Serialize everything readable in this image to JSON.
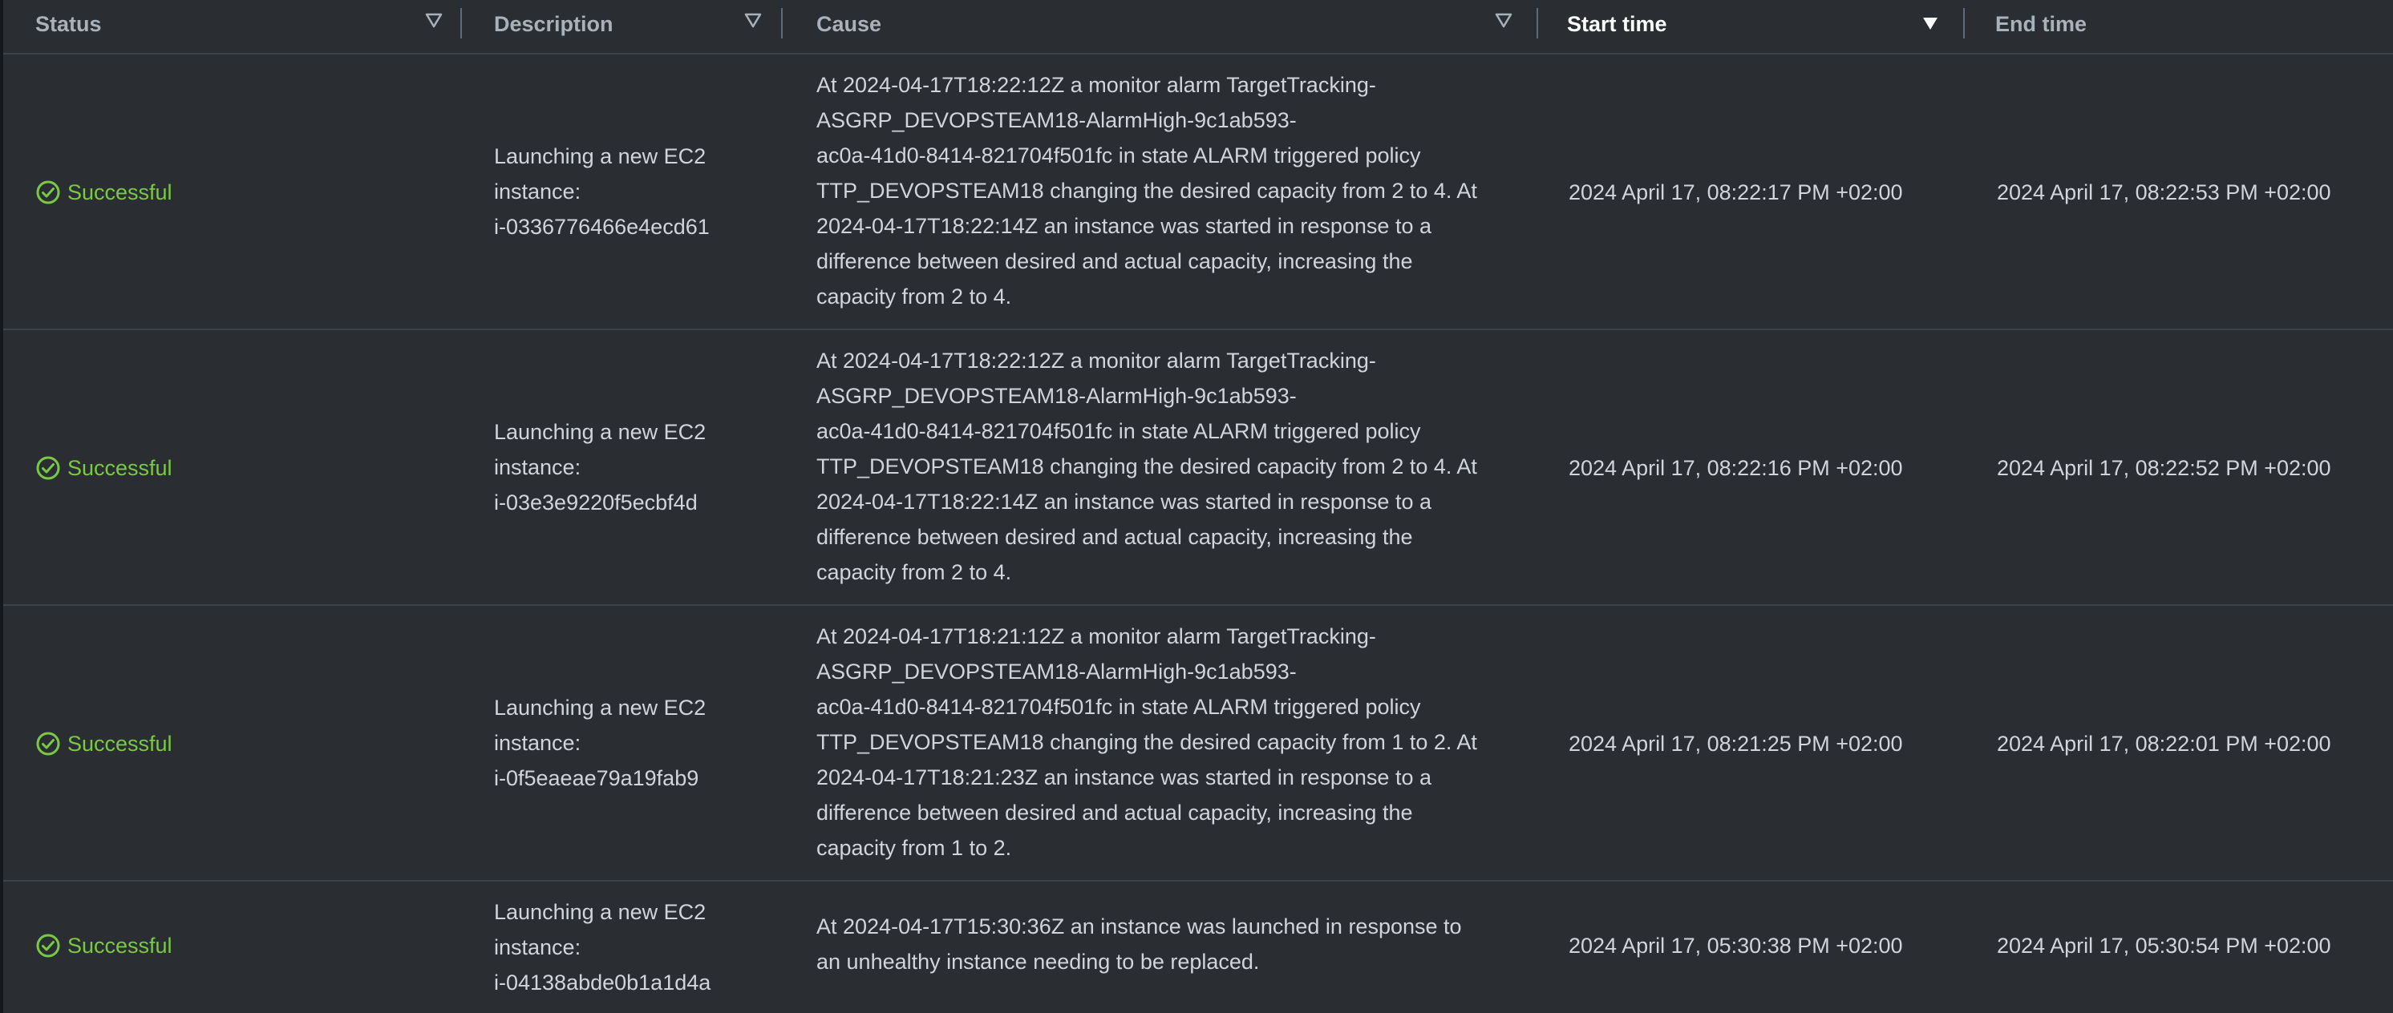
{
  "columns": {
    "status": "Status",
    "description": "Description",
    "cause": "Cause",
    "start_time": "Start time",
    "end_time": "End time"
  },
  "sorted_column": "start_time",
  "colors": {
    "success": "#7ac943",
    "background": "#2a2e33",
    "header_text": "#a9b1ba",
    "body_text": "#d1d5db"
  },
  "rows": [
    {
      "status": "Successful",
      "description": [
        "Launching a new EC2",
        "instance:",
        "i-0336776466e4ecd61"
      ],
      "cause": [
        "At 2024-04-17T18:22:12Z a monitor alarm TargetTracking-",
        "ASGRP_DEVOPSTEAM18-AlarmHigh-9c1ab593-",
        "ac0a-41d0-8414-821704f501fc in state ALARM triggered policy",
        "TTP_DEVOPSTEAM18 changing the desired capacity from 2 to 4. At",
        "2024-04-17T18:22:14Z an instance was started in response to a",
        "difference between desired and actual capacity, increasing the",
        "capacity from 2 to 4."
      ],
      "start_time": "2024 April 17, 08:22:17 PM +02:00",
      "end_time": "2024 April 17, 08:22:53 PM +02:00"
    },
    {
      "status": "Successful",
      "description": [
        "Launching a new EC2",
        "instance:",
        "i-03e3e9220f5ecbf4d"
      ],
      "cause": [
        "At 2024-04-17T18:22:12Z a monitor alarm TargetTracking-",
        "ASGRP_DEVOPSTEAM18-AlarmHigh-9c1ab593-",
        "ac0a-41d0-8414-821704f501fc in state ALARM triggered policy",
        "TTP_DEVOPSTEAM18 changing the desired capacity from 2 to 4. At",
        "2024-04-17T18:22:14Z an instance was started in response to a",
        "difference between desired and actual capacity, increasing the",
        "capacity from 2 to 4."
      ],
      "start_time": "2024 April 17, 08:22:16 PM +02:00",
      "end_time": "2024 April 17, 08:22:52 PM +02:00"
    },
    {
      "status": "Successful",
      "description": [
        "Launching a new EC2",
        "instance:",
        "i-0f5eaeae79a19fab9"
      ],
      "cause": [
        "At 2024-04-17T18:21:12Z a monitor alarm TargetTracking-",
        "ASGRP_DEVOPSTEAM18-AlarmHigh-9c1ab593-",
        "ac0a-41d0-8414-821704f501fc in state ALARM triggered policy",
        "TTP_DEVOPSTEAM18 changing the desired capacity from 1 to 2. At",
        "2024-04-17T18:21:23Z an instance was started in response to a",
        "difference between desired and actual capacity, increasing the",
        "capacity from 1 to 2."
      ],
      "start_time": "2024 April 17, 08:21:25 PM +02:00",
      "end_time": "2024 April 17, 08:22:01 PM +02:00"
    },
    {
      "status": "Successful",
      "description": [
        "Launching a new EC2",
        "instance:",
        "i-04138abde0b1a1d4a"
      ],
      "cause": [
        "At 2024-04-17T15:30:36Z an instance was launched in response to",
        "an unhealthy instance needing to be replaced."
      ],
      "start_time": "2024 April 17, 05:30:38 PM +02:00",
      "end_time": "2024 April 17, 05:30:54 PM +02:00"
    }
  ]
}
